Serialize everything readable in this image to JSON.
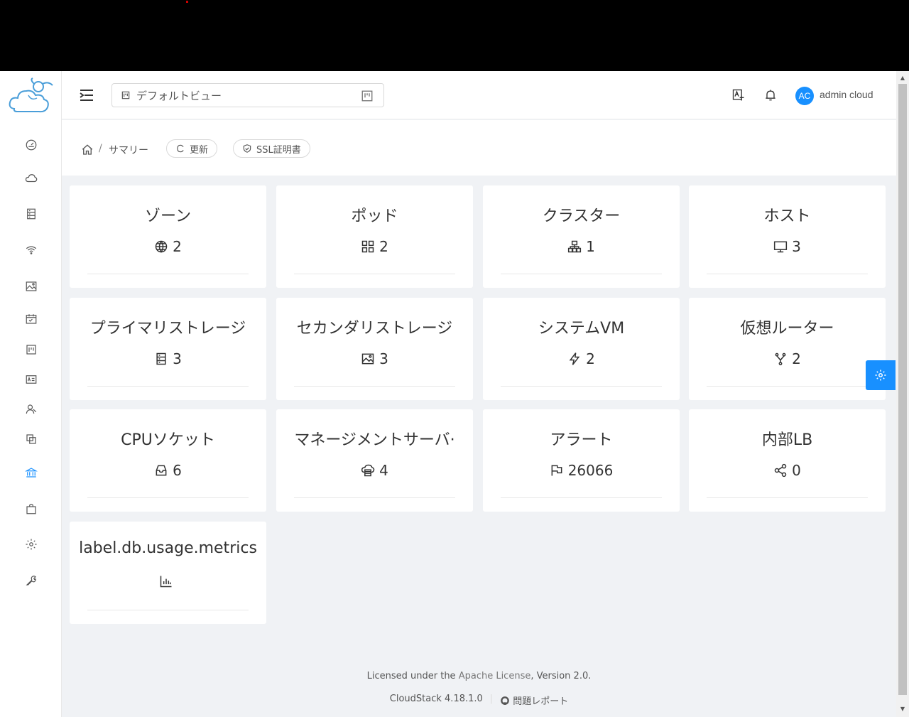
{
  "header": {
    "view_select": "デフォルトビュー",
    "avatar_initials": "AC",
    "username": "admin cloud"
  },
  "breadcrumb": {
    "separator": "/",
    "current": "サマリー"
  },
  "actions": {
    "refresh": "更新",
    "ssl": "SSL証明書"
  },
  "cards": [
    {
      "title": "ゾーン",
      "value": "2",
      "icon": "global-icon"
    },
    {
      "title": "ポッド",
      "value": "2",
      "icon": "appstore-icon"
    },
    {
      "title": "クラスター",
      "value": "1",
      "icon": "cluster-icon"
    },
    {
      "title": "ホスト",
      "value": "3",
      "icon": "desktop-icon"
    },
    {
      "title": "プライマリストレージ",
      "value": "3",
      "icon": "database-icon"
    },
    {
      "title": "セカンダリストレージ",
      "value": "3",
      "icon": "picture-icon"
    },
    {
      "title": "システムVM",
      "value": "2",
      "icon": "thunderbolt-icon"
    },
    {
      "title": "仮想ルーター",
      "value": "2",
      "icon": "fork-icon"
    },
    {
      "title": "CPUソケット",
      "value": "6",
      "icon": "inbox-icon"
    },
    {
      "title": "マネージメントサーバ·",
      "value": "4",
      "icon": "cloud-server-icon"
    },
    {
      "title": "アラート",
      "value": "26066",
      "icon": "flag-icon"
    },
    {
      "title": "内部LB",
      "value": "0",
      "icon": "share-icon"
    },
    {
      "title": "label.db.usage.metrics",
      "value": "",
      "icon": "bar-chart-icon"
    }
  ],
  "footer": {
    "license_prefix": "Licensed under the ",
    "license_link": "Apache License",
    "license_suffix": ", Version 2.0.",
    "version": "CloudStack 4.18.1.0",
    "report_issue": "問題レポート"
  },
  "colors": {
    "accent": "#1890ff",
    "background": "#f0f2f5"
  }
}
